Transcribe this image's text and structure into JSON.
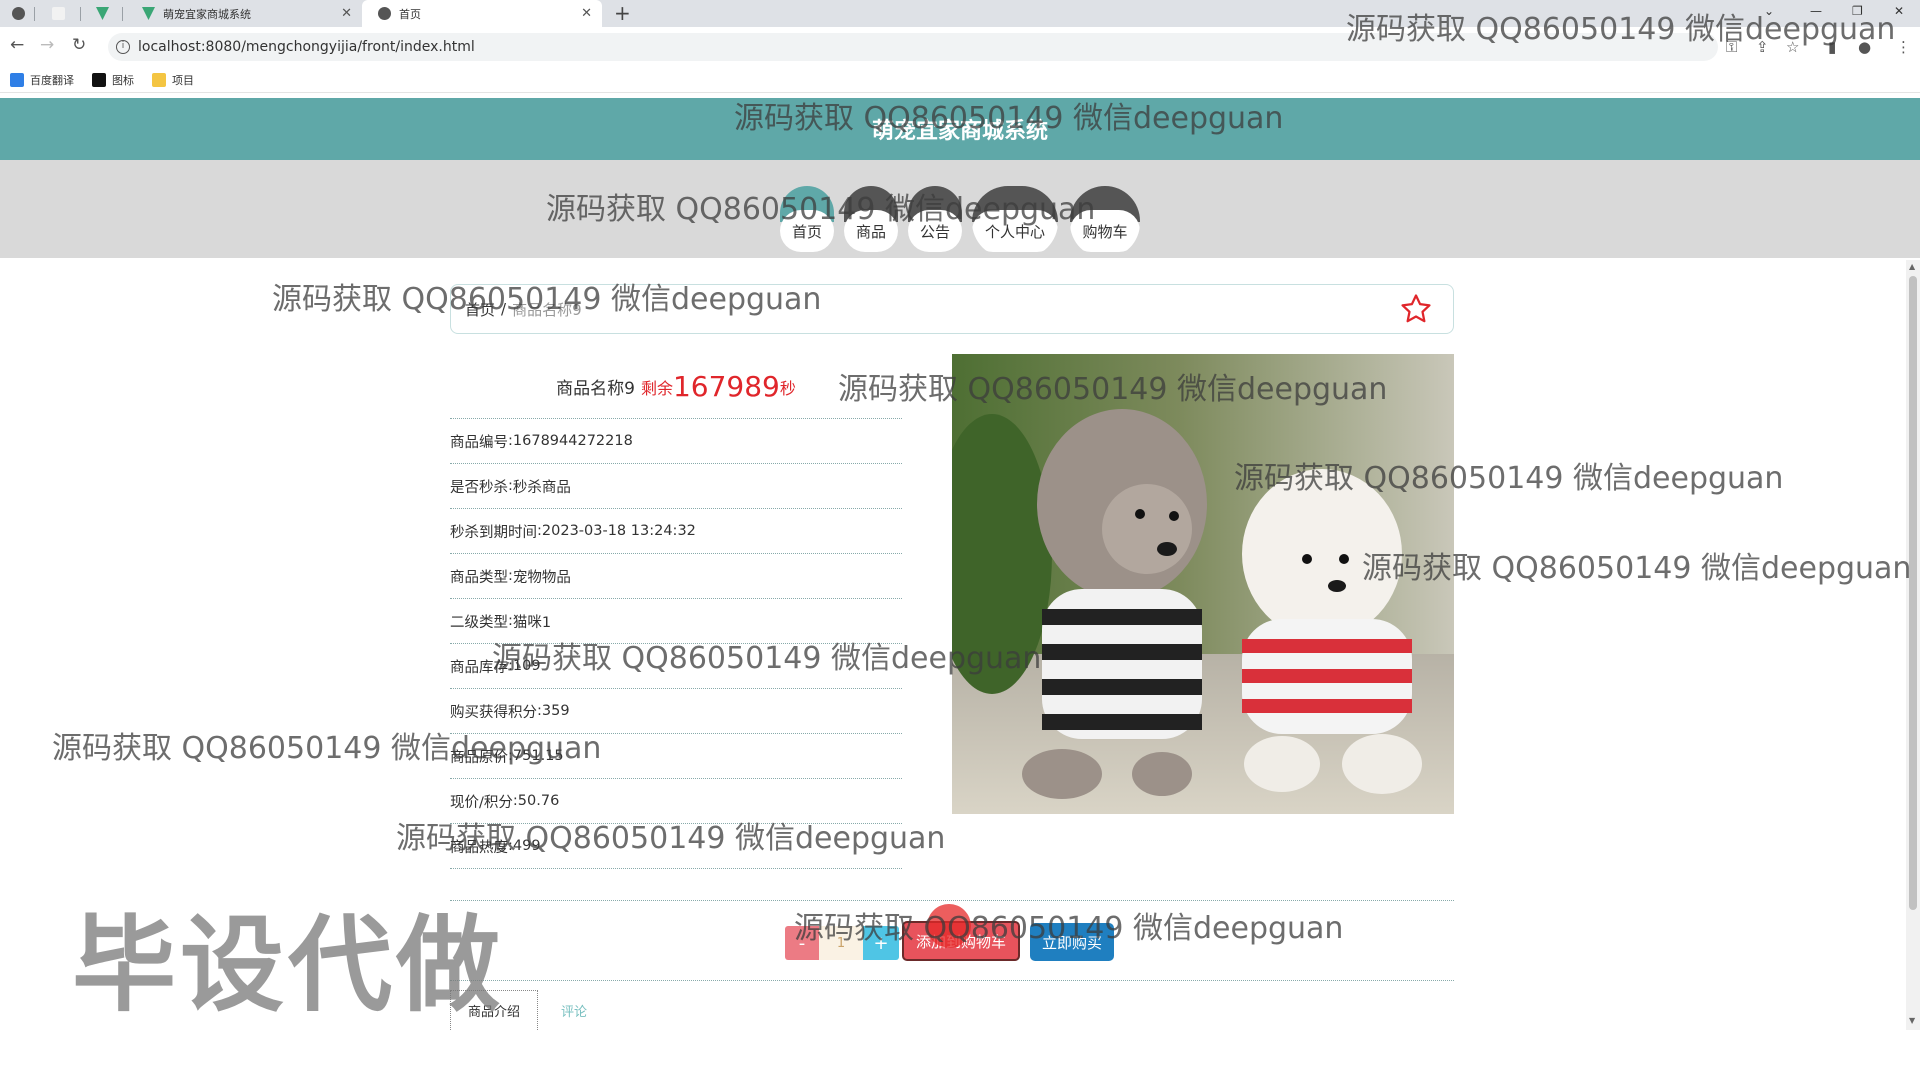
{
  "browser": {
    "tabs": [
      {
        "title": "",
        "active": false
      },
      {
        "title": "",
        "active": false
      },
      {
        "title": "",
        "active": false
      },
      {
        "title": "萌宠宜家商城系统",
        "active": false
      },
      {
        "title": "首页",
        "active": true
      }
    ],
    "close_glyph": "✕",
    "new_tab_glyph": "+",
    "url": "localhost:8080/mengchongyijia/front/index.html",
    "bookmarks": [
      {
        "label": "百度翻译",
        "icon": "translate-icon",
        "color": "#2f7fe6"
      },
      {
        "label": "图标",
        "icon": "image-icon",
        "color": "#111111"
      },
      {
        "label": "项目",
        "icon": "folder-icon",
        "color": "#f4c542"
      }
    ]
  },
  "site": {
    "title": "萌宠宜家商城系统",
    "nav": [
      {
        "label": "首页",
        "active": true
      },
      {
        "label": "商品",
        "active": false
      },
      {
        "label": "公告",
        "active": false
      },
      {
        "label": "个人中心",
        "active": false
      },
      {
        "label": "购物车",
        "active": false
      }
    ]
  },
  "breadcrumb": {
    "home": "首页",
    "sep": "/",
    "current": "商品名称9"
  },
  "product": {
    "name": "商品名称9",
    "remain_label": "剩余",
    "countdown": "167989",
    "countdown_unit": "秒",
    "fields": [
      {
        "label": "商品编号",
        "value": "1678944272218"
      },
      {
        "label": "是否秒杀",
        "value": "秒杀商品"
      },
      {
        "label": "秒杀到期时间",
        "value": "2023-03-18 13:24:32"
      },
      {
        "label": "商品类型",
        "value": "宠物物品"
      },
      {
        "label": "二级类型",
        "value": "猫咪1"
      },
      {
        "label": "商品库存",
        "value": "109"
      },
      {
        "label": "购买获得积分",
        "value": "359"
      },
      {
        "label": "商品原价",
        "value": "751.15"
      },
      {
        "label": "现价/积分",
        "value": "50.76"
      },
      {
        "label": "商品热度",
        "value": "499"
      }
    ]
  },
  "actions": {
    "minus": "-",
    "quantity": "1",
    "plus": "+",
    "add_cart": "添加到购物车",
    "buy_now": "立即购买"
  },
  "detail_tabs": {
    "intro": "商品介绍",
    "review": "评论"
  },
  "watermark": {
    "text": "源码获取 QQ86050149 微信deepguan",
    "big": "毕设代做"
  },
  "colors": {
    "header": "#5fa8a8",
    "accent_red": "#e0262b",
    "buy_blue": "#1f7fc0",
    "cart_red": "#e8535c"
  }
}
